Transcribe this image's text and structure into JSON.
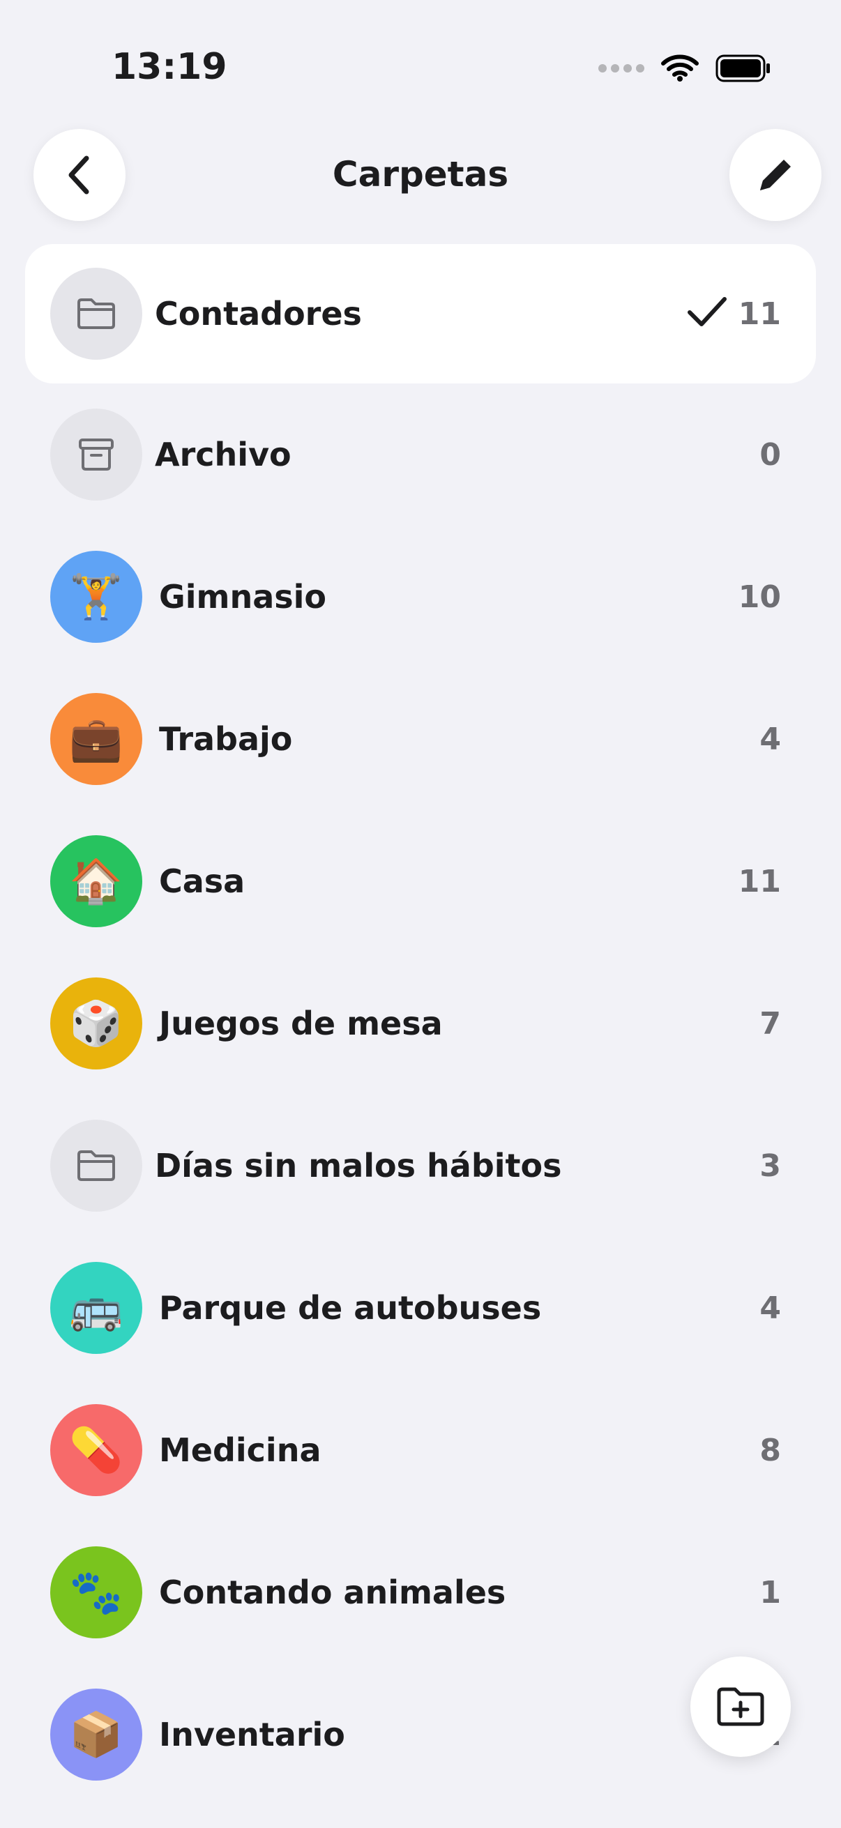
{
  "status_bar": {
    "time": "13:19"
  },
  "header": {
    "title": "Carpetas"
  },
  "folders": [
    {
      "label": "Contadores",
      "count": "11",
      "icon": "folder-icon",
      "color": "#e5e5ea",
      "emoji": "",
      "selected": true
    },
    {
      "label": "Archivo",
      "count": "0",
      "icon": "archive-icon",
      "color": "#e5e5ea",
      "emoji": ""
    },
    {
      "label": "Gimnasio",
      "count": "10",
      "icon": "weightlifter-emoji",
      "color": "#5fa3f5",
      "emoji": "🏋️"
    },
    {
      "label": "Trabajo",
      "count": "4",
      "icon": "briefcase-emoji",
      "color": "#f98b3a",
      "emoji": "💼"
    },
    {
      "label": "Casa",
      "count": "11",
      "icon": "house-emoji",
      "color": "#27c35f",
      "emoji": "🏠"
    },
    {
      "label": "Juegos de mesa",
      "count": "7",
      "icon": "dice-emoji",
      "color": "#e9b30c",
      "emoji": "🎲"
    },
    {
      "label": "Días sin malos hábitos",
      "count": "3",
      "icon": "folder-icon",
      "color": "#e5e5ea",
      "emoji": ""
    },
    {
      "label": "Parque de autobuses",
      "count": "4",
      "icon": "bus-emoji",
      "color": "#33d4c0",
      "emoji": "🚌"
    },
    {
      "label": "Medicina",
      "count": "8",
      "icon": "pill-emoji",
      "color": "#f76a6a",
      "emoji": "💊"
    },
    {
      "label": "Contando animales",
      "count": "1",
      "icon": "paw-prints-emoji",
      "color": "#7ac41e",
      "emoji": "🐾"
    },
    {
      "label": "Inventario",
      "count": "1",
      "icon": "package-emoji",
      "color": "#8a93f6",
      "emoji": "📦"
    }
  ],
  "colors": {
    "background": "#f2f2f7",
    "selected_row": "#ffffff",
    "text": "#1c1c1e",
    "count_text": "#6e6e73"
  }
}
